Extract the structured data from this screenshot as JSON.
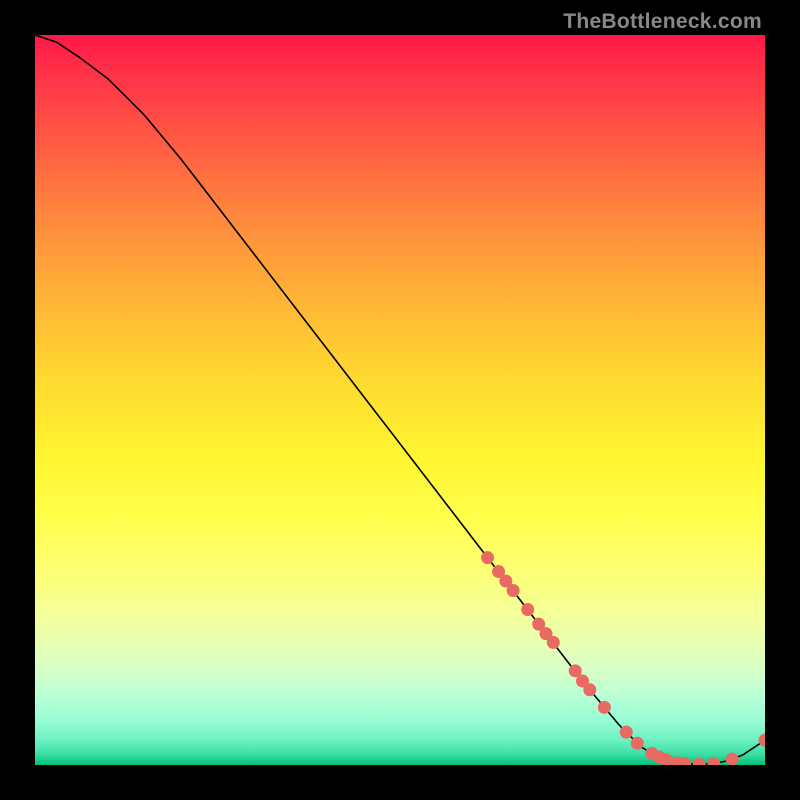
{
  "attribution": "TheBottleneck.com",
  "colors": {
    "frame": "#000000",
    "curve_stroke": "#000000",
    "marker_fill": "#e86a62",
    "marker_stroke": "#c94a42"
  },
  "chart_data": {
    "type": "line",
    "title": "",
    "xlabel": "",
    "ylabel": "",
    "xlim": [
      0,
      100
    ],
    "ylim": [
      0,
      100
    ],
    "grid": false,
    "legend": false,
    "curve": {
      "x": [
        0,
        3,
        6,
        10,
        15,
        20,
        25,
        30,
        35,
        40,
        45,
        50,
        55,
        60,
        65,
        70,
        75,
        80,
        83,
        85,
        87,
        89,
        91,
        93,
        95,
        97,
        100
      ],
      "y": [
        100,
        99,
        97,
        94,
        89,
        83,
        76.5,
        70,
        63.5,
        57,
        50.5,
        44,
        37.5,
        31,
        24.5,
        18,
        11.5,
        5.5,
        2.5,
        1.3,
        0.6,
        0.2,
        0.1,
        0.2,
        0.6,
        1.4,
        3.4
      ]
    },
    "markers": [
      {
        "x": 62.0,
        "y": 28.4
      },
      {
        "x": 63.5,
        "y": 26.5
      },
      {
        "x": 64.5,
        "y": 25.2
      },
      {
        "x": 65.5,
        "y": 23.9
      },
      {
        "x": 67.5,
        "y": 21.3
      },
      {
        "x": 69.0,
        "y": 19.3
      },
      {
        "x": 70.0,
        "y": 18.0
      },
      {
        "x": 71.0,
        "y": 16.8
      },
      {
        "x": 74.0,
        "y": 12.9
      },
      {
        "x": 75.0,
        "y": 11.5
      },
      {
        "x": 76.0,
        "y": 10.3
      },
      {
        "x": 78.0,
        "y": 7.9
      },
      {
        "x": 81.0,
        "y": 4.5
      },
      {
        "x": 82.5,
        "y": 3.0
      },
      {
        "x": 84.5,
        "y": 1.6
      },
      {
        "x": 85.5,
        "y": 1.1
      },
      {
        "x": 86.5,
        "y": 0.7
      },
      {
        "x": 88.0,
        "y": 0.3
      },
      {
        "x": 89.0,
        "y": 0.2
      },
      {
        "x": 91.0,
        "y": 0.1
      },
      {
        "x": 93.0,
        "y": 0.2
      },
      {
        "x": 95.5,
        "y": 0.8
      },
      {
        "x": 100.0,
        "y": 3.4
      }
    ]
  }
}
